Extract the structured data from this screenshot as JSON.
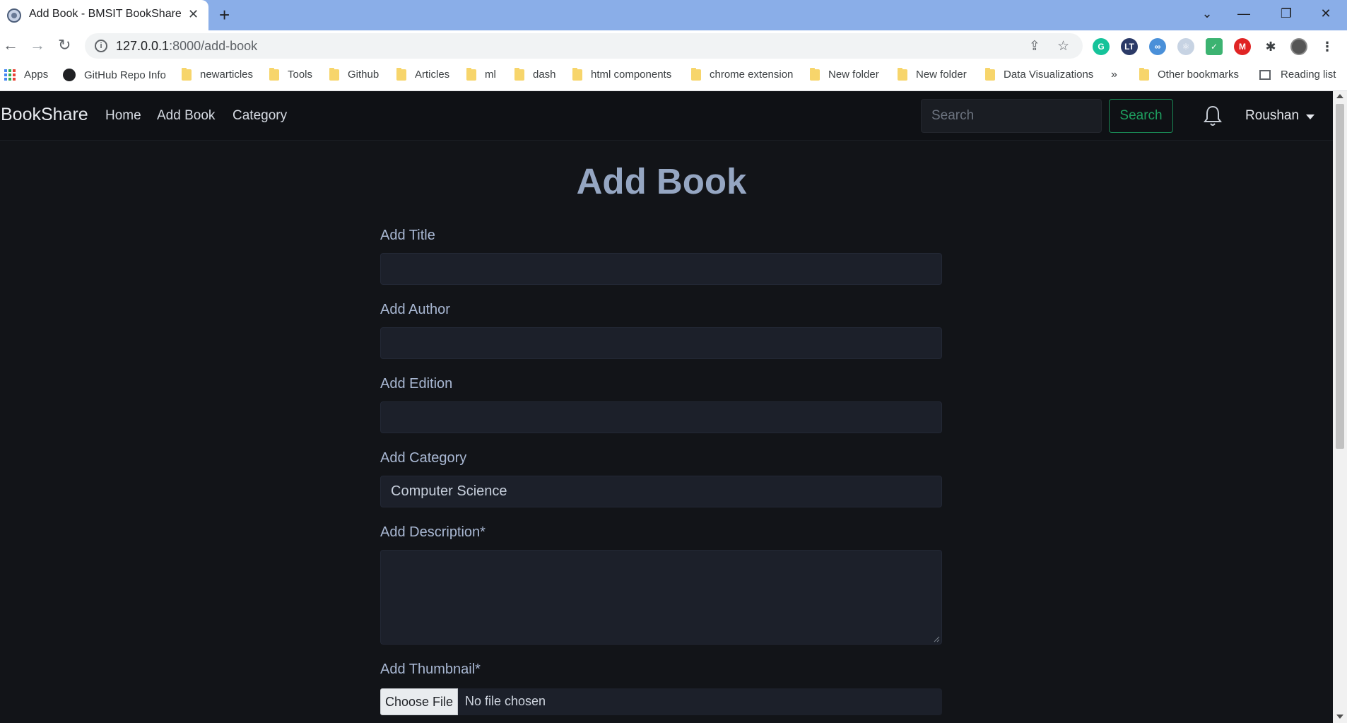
{
  "browser": {
    "tab_title": "Add Book - BMSIT BookShare",
    "new_tab": "+",
    "url_host": "127.0.0.1",
    "url_path": ":8000/add-book",
    "window_icons": [
      "chevron-down-icon",
      "minimize-icon",
      "restore-icon",
      "close-icon"
    ],
    "bookmarks": [
      {
        "label": "Apps",
        "icon": "apps-icon"
      },
      {
        "label": "GitHub Repo Info",
        "icon": "github-icon"
      },
      {
        "label": "newarticles",
        "icon": "folder-icon"
      },
      {
        "label": "Tools",
        "icon": "folder-icon"
      },
      {
        "label": "Github",
        "icon": "folder-icon"
      },
      {
        "label": "Articles",
        "icon": "folder-icon"
      },
      {
        "label": "ml",
        "icon": "folder-icon"
      },
      {
        "label": "dash",
        "icon": "folder-icon"
      },
      {
        "label": "html components",
        "icon": "folder-icon"
      },
      {
        "label": "chrome extension",
        "icon": "folder-icon"
      },
      {
        "label": "New folder",
        "icon": "folder-icon"
      },
      {
        "label": "New folder",
        "icon": "folder-icon"
      },
      {
        "label": "Data Visualizations",
        "icon": "folder-icon"
      }
    ],
    "overflow": "»",
    "other_bookmarks": "Other bookmarks",
    "reading_list": "Reading list"
  },
  "navbar": {
    "brand": "BookShare",
    "links": [
      "Home",
      "Add Book",
      "Category"
    ],
    "search_placeholder": "Search",
    "search_button": "Search",
    "user": "Roushan"
  },
  "form": {
    "heading": "Add Book",
    "title_label": "Add Title",
    "author_label": "Add Author",
    "edition_label": "Add Edition",
    "category_label": "Add Category",
    "category_value": "Computer Science",
    "description_label": "Add Description*",
    "thumbnail_label": "Add Thumbnail*",
    "file_button": "Choose File",
    "file_status": "No file chosen"
  },
  "colors": {
    "page_bg": "#121418",
    "navbar_bg": "#0f1115",
    "field_bg": "#1c202a",
    "heading": "#95a6c2",
    "label": "#a9b8d3",
    "success": "#198754",
    "chrome_tabstrip": "#8aaee8"
  }
}
